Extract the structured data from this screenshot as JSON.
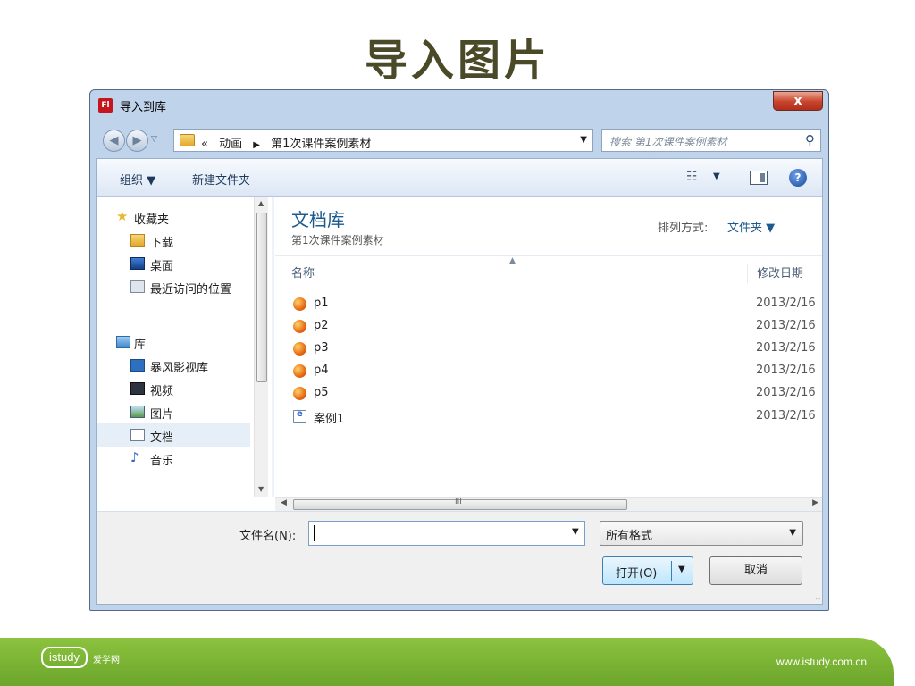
{
  "slide": {
    "title": "导入图片"
  },
  "dialog": {
    "app_icon": "Fl",
    "title": "导入到库",
    "close": "x"
  },
  "address": {
    "prefix": "«",
    "crumbs": [
      "动画",
      "第1次课件案例素材"
    ],
    "search_placeholder": "搜索 第1次课件案例素材"
  },
  "toolbar": {
    "organize": "组织 ▼",
    "new_folder": "新建文件夹"
  },
  "nav": {
    "items": [
      {
        "label": "收藏夹",
        "icon": "star-icon"
      },
      {
        "label": "下载",
        "icon": "download-folder-icon"
      },
      {
        "label": "桌面",
        "icon": "desktop-icon"
      },
      {
        "label": "最近访问的位置",
        "icon": "recent-places-icon"
      },
      {
        "label": "库",
        "icon": "library-icon"
      },
      {
        "label": "暴风影视库",
        "icon": "video-library-icon"
      },
      {
        "label": "视频",
        "icon": "film-icon"
      },
      {
        "label": "图片",
        "icon": "picture-icon"
      },
      {
        "label": "文档",
        "icon": "document-icon"
      },
      {
        "label": "音乐",
        "icon": "music-icon"
      }
    ],
    "selected": "文档"
  },
  "main": {
    "library_title": "文档库",
    "library_sub": "第1次课件案例素材",
    "arrange_label": "排列方式:",
    "arrange_value": "文件夹 ▼",
    "col_name": "名称",
    "col_date": "修改日期",
    "files": [
      {
        "name": "p1",
        "date": "2013/2/16",
        "icon": "image-file-icon"
      },
      {
        "name": "p2",
        "date": "2013/2/16",
        "icon": "image-file-icon"
      },
      {
        "name": "p3",
        "date": "2013/2/16",
        "icon": "image-file-icon"
      },
      {
        "name": "p4",
        "date": "2013/2/16",
        "icon": "image-file-icon"
      },
      {
        "name": "p5",
        "date": "2013/2/16",
        "icon": "image-file-icon"
      },
      {
        "name": "案例1",
        "date": "2013/2/16",
        "icon": "html-file-icon"
      }
    ],
    "hscroll_grip": "III"
  },
  "bottom": {
    "filename_label": "文件名(N):",
    "filename_value": "",
    "type_value": "所有格式",
    "open_label": "打开(O)",
    "cancel_label": "取消"
  },
  "footer": {
    "logo": "istudy",
    "brand": "爱学网",
    "url": "www.istudy.com.cn"
  },
  "colors": {
    "title_text": "#4a4a28",
    "footer_green": "#7ab535",
    "link_blue": "#1e5b8c"
  }
}
